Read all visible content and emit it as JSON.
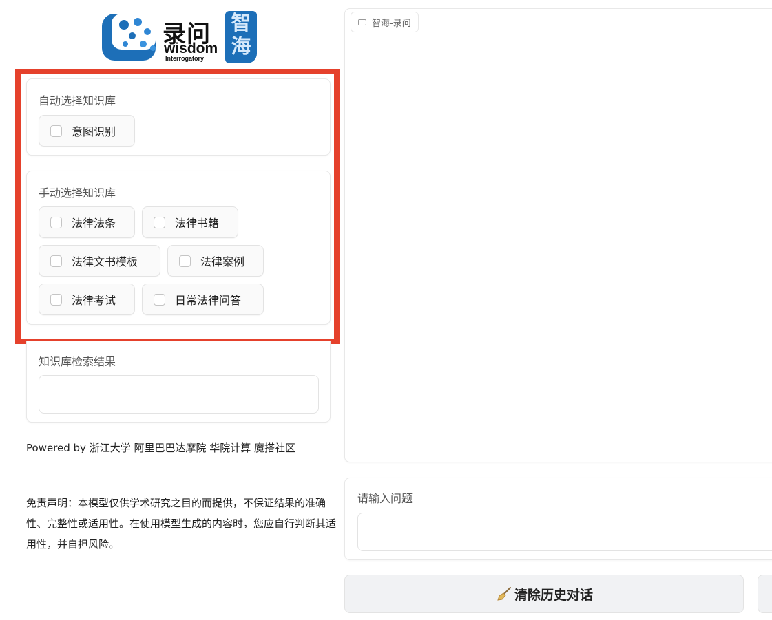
{
  "logo": {
    "title_cn": "录问",
    "title_en": "wisdom",
    "subtitle_en": "Interrogatory",
    "seal_text": "智海"
  },
  "auto_select": {
    "title": "自动选择知识库",
    "options": [
      {
        "label": "意图识别",
        "checked": false
      }
    ]
  },
  "manual_select": {
    "title": "手动选择知识库",
    "options": [
      {
        "label": "法律法条",
        "checked": false
      },
      {
        "label": "法律书籍",
        "checked": false
      },
      {
        "label": "法律文书模板",
        "checked": false
      },
      {
        "label": "法律案例",
        "checked": false
      },
      {
        "label": "法律考试",
        "checked": false
      },
      {
        "label": "日常法律问答",
        "checked": false
      }
    ]
  },
  "retrieval": {
    "title": "知识库检索结果",
    "value": ""
  },
  "footer": {
    "powered_by": "Powered by 浙江大学 阿里巴巴达摩院 华院计算 魔搭社区",
    "disclaimer": "免责声明：本模型仅供学术研究之目的而提供，不保证结果的准确性、完整性或适用性。在使用模型生成的内容时，您应自行判断其适用性，并自担风险。"
  },
  "chat": {
    "label": "智海-录问"
  },
  "question": {
    "label": "请输入问题",
    "value": ""
  },
  "buttons": {
    "clear_history": "清除历史对话"
  },
  "colors": {
    "highlight": "#e5412c",
    "logo_blue": "#1d6fb8"
  }
}
